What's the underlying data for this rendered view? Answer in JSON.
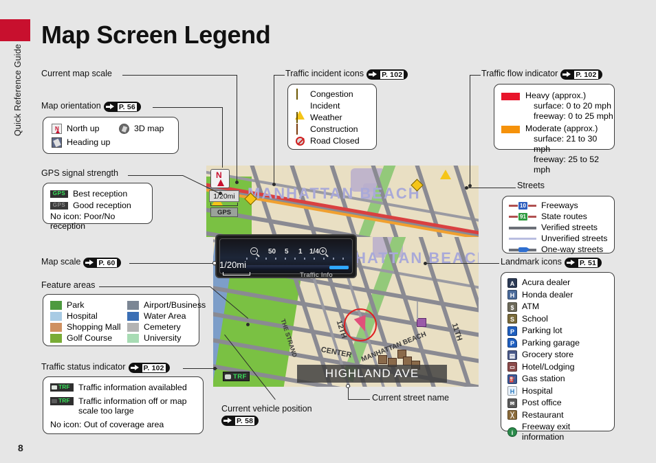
{
  "doc": {
    "side_tab_label": "Quick Reference Guide",
    "page_number": "8",
    "title": "Map Screen Legend"
  },
  "callouts": {
    "current_map_scale": "Current map scale",
    "traffic_incident_icons": "Traffic incident icons",
    "traffic_flow_indicator": "Traffic flow indicator",
    "map_orientation": "Map orientation",
    "gps_signal_strength": "GPS signal strength",
    "streets": "Streets",
    "map_scale": "Map scale",
    "feature_areas": "Feature areas",
    "landmark_icons": "Landmark icons",
    "traffic_status_indicator": "Traffic status indicator",
    "current_vehicle_position": "Current vehicle position",
    "current_street_name": "Current street name"
  },
  "refs": {
    "p102a": "P. 102",
    "p102b": "P. 102",
    "p56": "P. 56",
    "p60": "P. 60",
    "p51": "P. 51",
    "p102c": "P. 102",
    "p58": "P. 58"
  },
  "traffic_incidents": [
    {
      "label": "Congestion",
      "icon": "congestion-diamond-icon",
      "color": "#f5c518"
    },
    {
      "label": "Incident",
      "icon": "incident-triangle-icon",
      "color": "#f5c518"
    },
    {
      "label": "Weather",
      "icon": "weather-diamond-icon",
      "color": "#f5c518"
    },
    {
      "label": "Construction",
      "icon": "construction-diamond-icon",
      "color": "#e0732a"
    },
    {
      "label": "Road Closed",
      "icon": "road-closed-icon",
      "color": "#cfcfcf"
    }
  ],
  "traffic_flow": [
    {
      "color": "#e8152b",
      "title": "Heavy (approx.)",
      "line1": "surface: 0 to 20 mph",
      "line2": "freeway: 0 to 25 mph"
    },
    {
      "color": "#f5920b",
      "title": "Moderate (approx.)",
      "line1": "surface: 21 to 30 mph",
      "line2": "freeway: 25 to 52 mph"
    }
  ],
  "map_orientation": [
    {
      "label": "North up",
      "icon": "north-up-icon"
    },
    {
      "label": "3D map",
      "icon": "3d-map-icon"
    },
    {
      "label": "Heading up",
      "icon": "heading-up-icon"
    }
  ],
  "gps_signal": {
    "rows": [
      {
        "label": "Best reception",
        "icon": "gps-best-icon"
      },
      {
        "label": "Good reception",
        "icon": "gps-good-icon"
      }
    ],
    "note": "No icon: Poor/No reception"
  },
  "feature_areas": [
    {
      "label": "Park",
      "color": "#4d9a3f"
    },
    {
      "label": "Airport/Business",
      "color": "#7b8694"
    },
    {
      "label": "Hospital",
      "color": "#a8cbe4"
    },
    {
      "label": "Water Area",
      "color": "#3b6fb5"
    },
    {
      "label": "Shopping Mall",
      "color": "#cf9161"
    },
    {
      "label": "Cemetery",
      "color": "#b3b3b3"
    },
    {
      "label": "Golf Course",
      "color": "#79ac36"
    },
    {
      "label": "University",
      "color": "#a8dcb4"
    }
  ],
  "streets": [
    {
      "label": "Freeways",
      "icon": "freeway-shield-icon",
      "shield": "10",
      "shield_color": "#2f5fbf",
      "line": "#b05050"
    },
    {
      "label": "State routes",
      "icon": "state-route-shield-icon",
      "shield": "91",
      "shield_color": "#2f9a3f",
      "line": "#b05050"
    },
    {
      "label": "Verified streets",
      "icon": "verified-street-line-icon",
      "line": "#6c7078"
    },
    {
      "label": "Unverified streets",
      "icon": "unverified-street-line-icon",
      "line": "#b9bde0"
    },
    {
      "label": "One-way streets",
      "icon": "one-way-street-icon",
      "line": "#6c7078"
    }
  ],
  "landmarks": [
    {
      "label": "Acura dealer",
      "icon": "acura-dealer-icon",
      "glyph": "A",
      "color": "#2b3a55"
    },
    {
      "label": "Honda dealer",
      "icon": "honda-dealer-icon",
      "glyph": "H",
      "color": "#4a6a9a"
    },
    {
      "label": "ATM",
      "icon": "atm-icon",
      "glyph": "$",
      "color": "#6d6a5a"
    },
    {
      "label": "School",
      "icon": "school-icon",
      "glyph": "S",
      "color": "#7a6b3a"
    },
    {
      "label": "Parking lot",
      "icon": "parking-lot-icon",
      "glyph": "P",
      "color": "#1f5fc0"
    },
    {
      "label": "Parking garage",
      "icon": "parking-garage-icon",
      "glyph": "P",
      "color": "#1f5fc0"
    },
    {
      "label": "Grocery store",
      "icon": "grocery-store-icon",
      "glyph": "▤",
      "color": "#4a5a8a"
    },
    {
      "label": "Hotel/Lodging",
      "icon": "hotel-lodging-icon",
      "glyph": "☰",
      "color": "#8a4a4a"
    },
    {
      "label": "Gas station",
      "icon": "gas-station-icon",
      "glyph": "⛽",
      "color": "#3a5a9a"
    },
    {
      "label": "Hospital",
      "icon": "hospital-icon",
      "glyph": "H",
      "color": "#4a9ad0"
    },
    {
      "label": "Post office",
      "icon": "post-office-icon",
      "glyph": "✉",
      "color": "#5a5a5a"
    },
    {
      "label": "Restaurant",
      "icon": "restaurant-icon",
      "glyph": "╳",
      "color": "#8a6a3a"
    },
    {
      "label": "Freeway exit information",
      "icon": "freeway-exit-info-icon",
      "glyph": "i",
      "color": "#2a8a4a"
    }
  ],
  "traffic_status": {
    "rows": [
      {
        "label": "Traffic information availabled",
        "icon": "traffic-on-icon",
        "text": "TRF"
      },
      {
        "label": "Traffic information off or map\nscale too large",
        "icon": "traffic-off-icon",
        "text": "TRF"
      }
    ],
    "note": "No icon: Out of coverage area"
  },
  "map": {
    "scale_chip": "1/20mi",
    "gps_chip": "GPS",
    "trf_chip": "TRF",
    "street_name": "HIGHLAND AVE",
    "north_icon": "north-up-compass-icon",
    "vehicle_icon": "current-vehicle-position-arrow-icon",
    "area_labels": [
      "MANHATTAN BEACH",
      "MANHATTAN BEACH"
    ],
    "street_labels": [
      "THE STRAND",
      "CENTER",
      "12TH",
      "11TH",
      "MANHATTAN BEACH"
    ],
    "scale_popup": {
      "current": "1/20mi",
      "ticks": [
        "50",
        "5",
        "1",
        "1/4"
      ],
      "zoom_out_icon": "zoom-out-icon",
      "zoom_in_icon": "zoom-in-icon",
      "traffic_info_button": "Traffic Info"
    }
  }
}
